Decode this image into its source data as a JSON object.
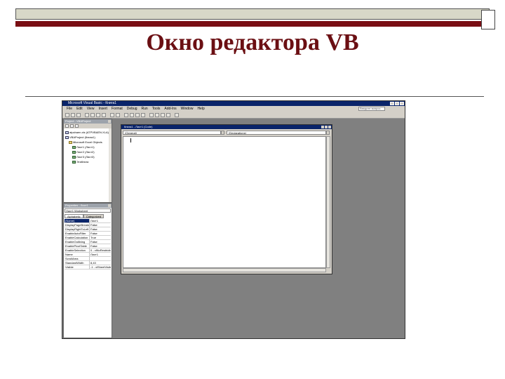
{
  "slide": {
    "title": "Окно редактора VB"
  },
  "vbe": {
    "window_title": "Microsoft Visual Basic - Книга1",
    "menu": [
      "File",
      "Edit",
      "View",
      "Insert",
      "Format",
      "Debug",
      "Run",
      "Tools",
      "Add-Ins",
      "Window",
      "Help"
    ],
    "help_hint": "Введите вопрос",
    "project_explorer": {
      "title": "Project - VBAProject",
      "items": [
        {
          "label": "atpvbaen.xls (ATPVBAEN.XLA)",
          "kind": "project"
        },
        {
          "label": "VBAProject (Книга1)",
          "kind": "project"
        },
        {
          "label": "Microsoft Excel Objects",
          "kind": "folder"
        },
        {
          "label": "Лист1 (Лист1)",
          "kind": "sheet"
        },
        {
          "label": "Лист2 (Лист2)",
          "kind": "sheet"
        },
        {
          "label": "Лист3 (Лист3)",
          "kind": "sheet"
        },
        {
          "label": "ЭтаКнига",
          "kind": "sheet"
        }
      ]
    },
    "properties": {
      "title": "Properties - Лист1",
      "object": "Лист1 Worksheet",
      "tabs": [
        "Alphabetic",
        "Categorized"
      ],
      "rows": [
        {
          "name": "(Name)",
          "value": "Лист1"
        },
        {
          "name": "DisplayPageBreaks",
          "value": "False"
        },
        {
          "name": "DisplayRightToLeft",
          "value": "False"
        },
        {
          "name": "EnableAutoFilter",
          "value": "False"
        },
        {
          "name": "EnableCalculation",
          "value": "True"
        },
        {
          "name": "EnableOutlining",
          "value": "False"
        },
        {
          "name": "EnablePivotTable",
          "value": "False"
        },
        {
          "name": "EnableSelection",
          "value": "0 - xlNoRestrictions"
        },
        {
          "name": "Name",
          "value": "Лист1"
        },
        {
          "name": "ScrollArea",
          "value": ""
        },
        {
          "name": "StandardWidth",
          "value": "8,43"
        },
        {
          "name": "Visible",
          "value": "-1 - xlSheetVisible"
        }
      ]
    },
    "code_window": {
      "title": "Книга1 - Лист1 (Code)",
      "object_combo": "(General)",
      "procedure_combo": "(Declarations)"
    }
  }
}
